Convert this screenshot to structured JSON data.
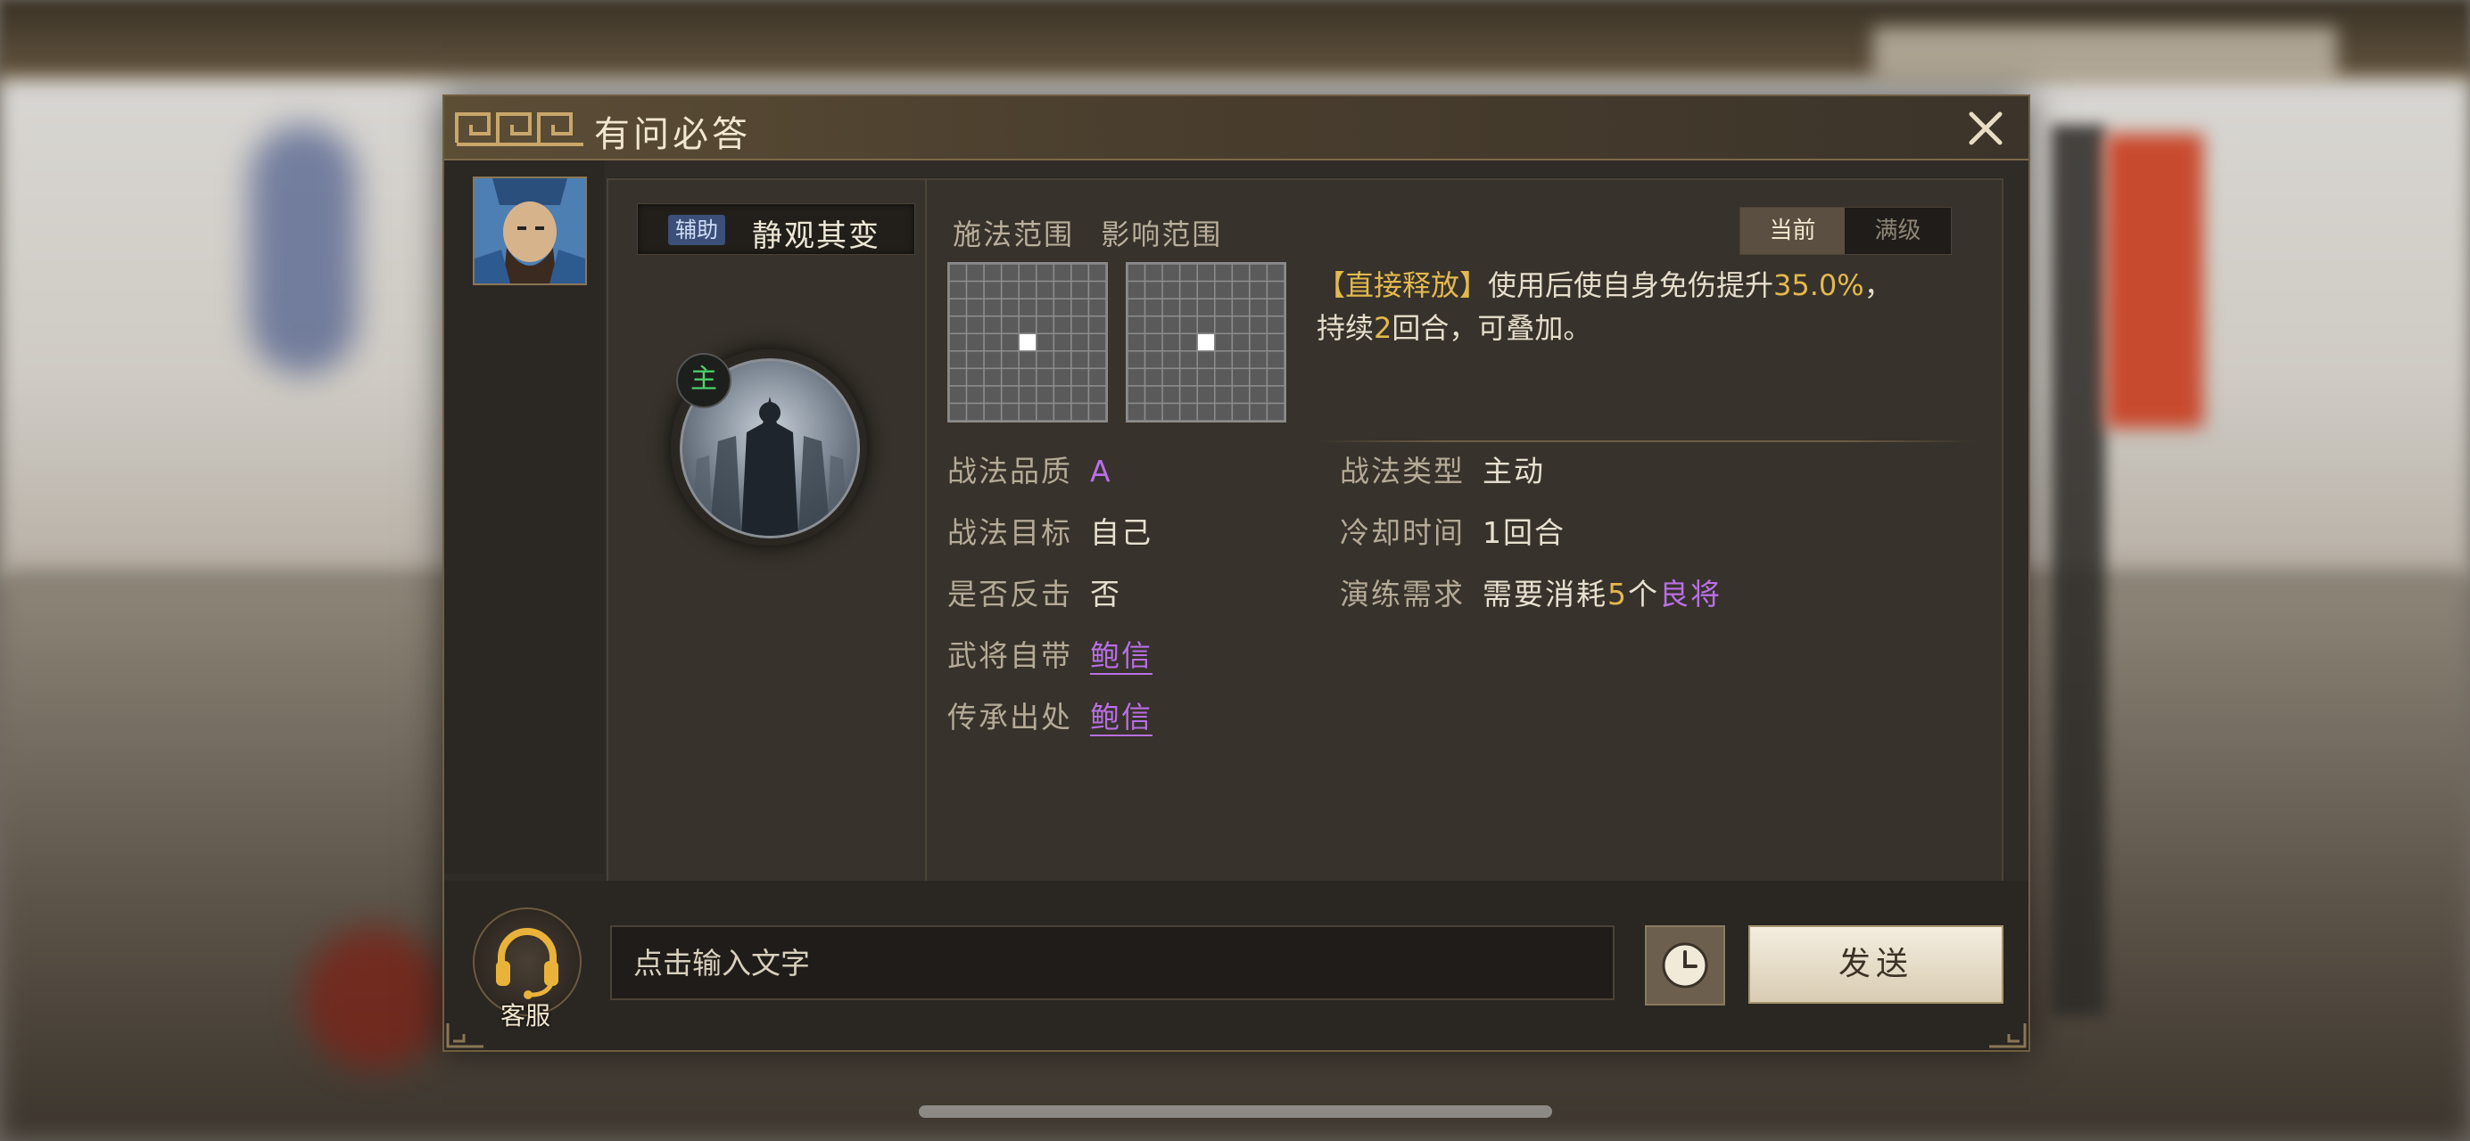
{
  "dialog": {
    "title": "有问必答"
  },
  "skill": {
    "type_tag": "辅助",
    "name": "静观其变",
    "badge": "主"
  },
  "range": {
    "cast_label": "施法范围",
    "effect_label": "影响范围"
  },
  "level_toggle": {
    "current": "当前",
    "max": "满级"
  },
  "description": {
    "tag": "【直接释放】",
    "text1": "使用后使自身免伤提升",
    "value": "35.0%",
    "text2": "，",
    "line2_prefix": "持续",
    "turns": "2",
    "line2_suffix": "回合，可叠加。"
  },
  "attributes": {
    "quality_label": "战法品质",
    "quality_value": "A",
    "target_label": "战法目标",
    "target_value": "自己",
    "counter_label": "是否反击",
    "counter_value": "否",
    "general_label": "武将自带",
    "general_value": "鲍信",
    "inherit_label": "传承出处",
    "inherit_value": "鲍信",
    "type_label": "战法类型",
    "type_value": "主动",
    "cooldown_label": "冷却时间",
    "cooldown_value": "1回合",
    "train_label": "演练需求",
    "train_prefix": "需要消耗",
    "train_count": "5",
    "train_mid": "个",
    "train_item": "良将"
  },
  "bottom": {
    "customer_service_label": "客服",
    "input_placeholder": "点击输入文字",
    "send_label": "发送"
  },
  "colors": {
    "gold": "#e3b94e",
    "purple": "#b96fe6",
    "panel": "#37322b",
    "title_bar": "#5c4d35"
  }
}
